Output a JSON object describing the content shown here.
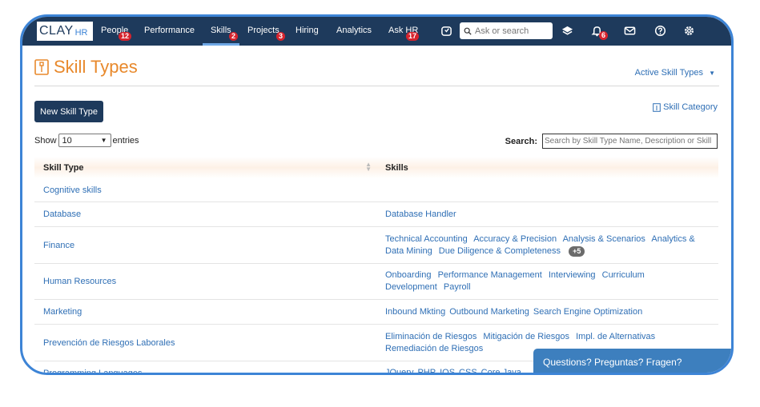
{
  "nav": {
    "logo_text": "CLAY",
    "logo_suffix": "HR",
    "items": [
      {
        "label": "People",
        "badge": "12"
      },
      {
        "label": "Performance",
        "badge": ""
      },
      {
        "label": "Skills",
        "badge": "2"
      },
      {
        "label": "Projects",
        "badge": "3"
      },
      {
        "label": "Hiring",
        "badge": ""
      },
      {
        "label": "Analytics",
        "badge": ""
      },
      {
        "label": "Ask HR",
        "badge": "17"
      }
    ],
    "active_item": "Skills",
    "search_placeholder": "Ask or search",
    "notification_count": "6"
  },
  "page": {
    "title": "Skill Types",
    "filter_label": "Active Skill Types",
    "new_button": "New Skill Type",
    "category_link": "Skill Category",
    "show_label": "Show",
    "entries_value": "10",
    "entries_label": "entries",
    "search_label": "Search:",
    "search_placeholder": "Search by Skill Type Name, Description or Skill"
  },
  "table": {
    "headers": [
      "Skill Type",
      "Skills"
    ],
    "rows": [
      {
        "type": "Cognitive skills",
        "skills": []
      },
      {
        "type": "Database",
        "skills": [
          "Database Handler"
        ]
      },
      {
        "type": "Finance",
        "skills": [
          "Technical Accounting",
          "Accuracy & Precision",
          "Analysis & Scenarios",
          "Analytics & Data Mining",
          "Due Diligence & Completeness"
        ],
        "more": "+5"
      },
      {
        "type": "Human Resources",
        "skills": [
          "Onboarding",
          "Performance Management",
          "Interviewing",
          "Curriculum Development",
          "Payroll"
        ]
      },
      {
        "type": "Marketing",
        "skills": [
          "Inbound Mkting",
          "Outbound Marketing",
          "Search Engine Optimization"
        ]
      },
      {
        "type": "Prevención de Riesgos Laborales",
        "skills": [
          "Eliminación de Riesgos",
          "Mitigación de Riesgos",
          "Impl. de Alternativas",
          "Remediación de Riesgos"
        ]
      },
      {
        "type": "Programming Languages",
        "skills": [
          "JQuery",
          "PHP",
          "IOS",
          "CSS",
          "Core Java"
        ]
      }
    ]
  },
  "chat": {
    "label": "Questions? Preguntas? Fragen?"
  },
  "colors": {
    "navbar": "#1e3a5c",
    "accent": "#e8892c",
    "link": "#2f6fb5",
    "badge": "#d6232d",
    "frame": "#3d84d6"
  }
}
